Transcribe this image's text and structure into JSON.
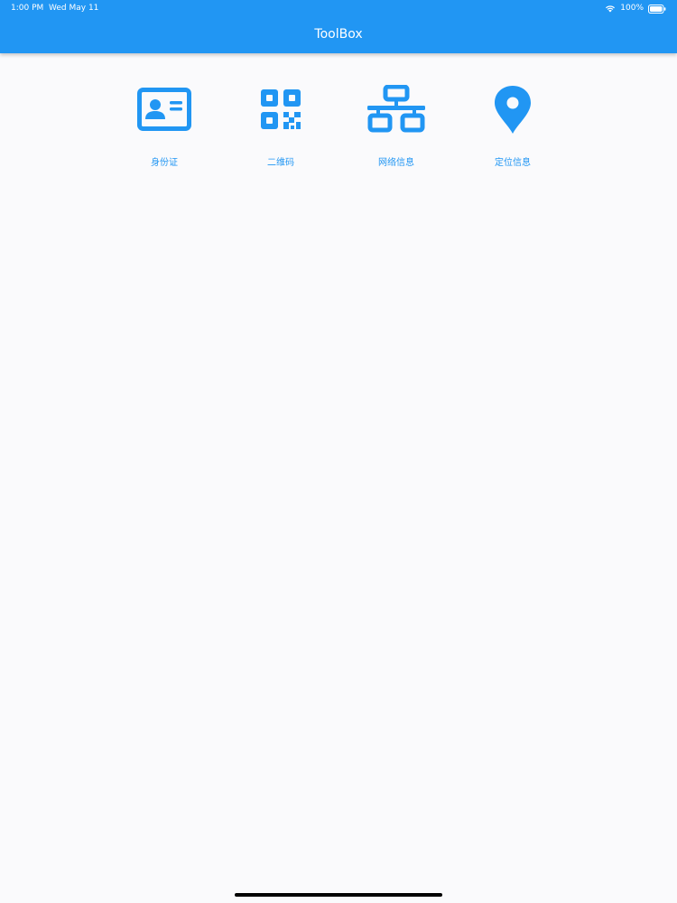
{
  "status_bar": {
    "time": "1:00 PM",
    "date": "Wed May 11",
    "battery": "100%",
    "wifi_icon": "wifi-icon",
    "battery_icon": "battery-icon"
  },
  "app_bar": {
    "title": "ToolBox",
    "background": "#2196f3",
    "text_color": "#ffffff"
  },
  "tools": [
    {
      "label": "身份证",
      "icon": "id-card-icon"
    },
    {
      "label": "二维码",
      "icon": "qr-code-icon"
    },
    {
      "label": "网络信息",
      "icon": "network-icon"
    },
    {
      "label": "定位信息",
      "icon": "location-pin-icon"
    }
  ],
  "colors": {
    "accent": "#2196f3",
    "page_background": "#fafafc"
  }
}
